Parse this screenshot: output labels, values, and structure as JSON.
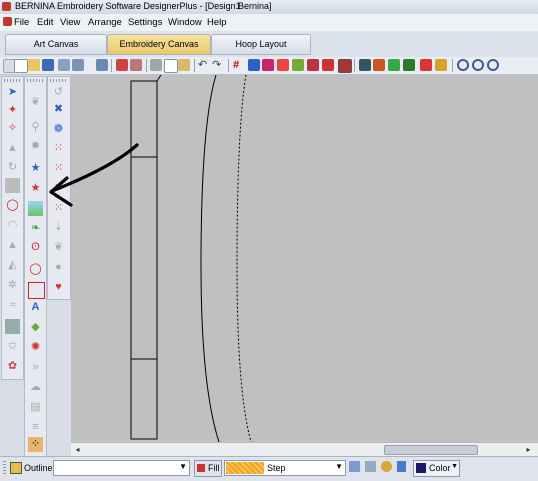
{
  "window": {
    "title": "BERNINA Embroidery Software DesignerPlus - [Design1",
    "title_suffix": "Bernina]"
  },
  "menu": [
    "File",
    "Edit",
    "View",
    "Arrange",
    "Settings",
    "Window",
    "Help"
  ],
  "tabs": [
    {
      "label": "Art Canvas",
      "active": false
    },
    {
      "label": "Embroidery Canvas",
      "active": true
    },
    {
      "label": "Hoop Layout",
      "active": false
    }
  ],
  "statusbar": {
    "outline_label": "Outline",
    "outline_value": "",
    "fill_label": "Fill",
    "step_label": "Step",
    "color_label": "Color"
  },
  "colors": {
    "canvas": "#c0c0c0",
    "accent": "#2a62c9",
    "fill_swatch": "#f3a01a",
    "color_swatch": "#1a1a6e"
  },
  "annotation": {
    "shape": "hand-drawn-arrow",
    "direction": "left",
    "color": "#000000"
  }
}
